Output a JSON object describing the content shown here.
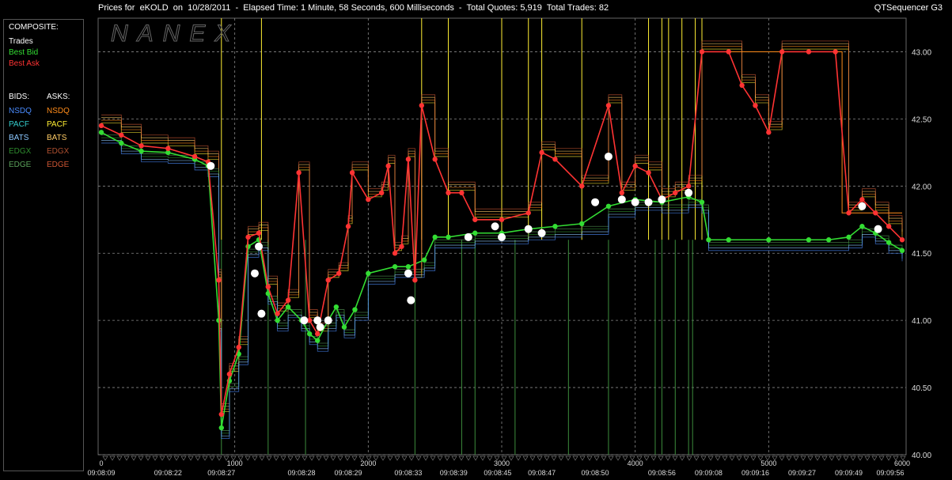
{
  "title": "Prices for  eKOLD  on  10/28/2011  -  Elapsed Time: 1 Minute, 58 Seconds, 600 Milliseconds  -  Total Quotes: 5,919  Total Trades: 82",
  "app_name": "QTSequencer G3",
  "watermark": "NANEX",
  "legend": {
    "composite_header": "COMPOSITE:",
    "composite": [
      {
        "label": "Trades",
        "color": "#ffffff"
      },
      {
        "label": "Best Bid",
        "color": "#33dd33"
      },
      {
        "label": "Best Ask",
        "color": "#ff3333"
      }
    ],
    "bids_header": "BIDS:",
    "asks_header": "ASKS:",
    "bids": [
      {
        "label": "NSDQ",
        "color": "#4a8cff"
      },
      {
        "label": "PACF",
        "color": "#33cccc"
      },
      {
        "label": "BATS",
        "color": "#8cc8ff"
      },
      {
        "label": "EDGX",
        "color": "#2e8b2e"
      },
      {
        "label": "EDGE",
        "color": "#5aa05a"
      }
    ],
    "asks": [
      {
        "label": "NSDQ",
        "color": "#ff8c1a"
      },
      {
        "label": "PACF",
        "color": "#ffee33"
      },
      {
        "label": "BATS",
        "color": "#ffcc66"
      },
      {
        "label": "EDGX",
        "color": "#b05030"
      },
      {
        "label": "EDGE",
        "color": "#cc5533"
      }
    ]
  },
  "chart_data": {
    "type": "line",
    "x_axis": {
      "ticks": [
        0,
        1000,
        2000,
        3000,
        4000,
        5000,
        6000
      ],
      "range": [
        0,
        6000
      ]
    },
    "y_axis": {
      "ticks": [
        "40.00",
        "40.50",
        "41.00",
        "41.50",
        "42.00",
        "42.50",
        "43.00"
      ],
      "range": [
        40.0,
        43.25
      ]
    },
    "time_labels": [
      "09:08:09",
      "09:08:22",
      "09:08:27",
      "09:08:28",
      "09:08:29",
      "09:08:33",
      "09:08:39",
      "09:08:45",
      "09:08:47",
      "09:08:50",
      "09:08:56",
      "09:09:08",
      "09:09:16",
      "09:09:27",
      "09:09:49",
      "09:09:56"
    ],
    "time_label_x": [
      0,
      500,
      900,
      1500,
      1850,
      2300,
      2640,
      2970,
      3300,
      3700,
      4200,
      4550,
      4900,
      5250,
      5600,
      6000
    ],
    "grid": true,
    "series": [
      {
        "name": "Best Bid",
        "color": "#33dd33",
        "points": [
          [
            0,
            42.4
          ],
          [
            150,
            42.32
          ],
          [
            300,
            42.26
          ],
          [
            500,
            42.25
          ],
          [
            700,
            42.2
          ],
          [
            800,
            42.15
          ],
          [
            880,
            41.0
          ],
          [
            900,
            40.2
          ],
          [
            960,
            40.55
          ],
          [
            1030,
            40.75
          ],
          [
            1100,
            41.55
          ],
          [
            1180,
            41.6
          ],
          [
            1250,
            41.2
          ],
          [
            1320,
            41.0
          ],
          [
            1400,
            41.1
          ],
          [
            1500,
            41.0
          ],
          [
            1560,
            40.9
          ],
          [
            1620,
            40.85
          ],
          [
            1700,
            41.0
          ],
          [
            1760,
            41.1
          ],
          [
            1820,
            40.95
          ],
          [
            1900,
            41.08
          ],
          [
            2000,
            41.35
          ],
          [
            2200,
            41.4
          ],
          [
            2300,
            41.4
          ],
          [
            2420,
            41.45
          ],
          [
            2500,
            41.62
          ],
          [
            2600,
            41.62
          ],
          [
            2800,
            41.65
          ],
          [
            3000,
            41.65
          ],
          [
            3200,
            41.68
          ],
          [
            3400,
            41.7
          ],
          [
            3600,
            41.72
          ],
          [
            3800,
            41.85
          ],
          [
            4000,
            41.9
          ],
          [
            4200,
            41.88
          ],
          [
            4400,
            41.92
          ],
          [
            4500,
            41.88
          ],
          [
            4550,
            41.6
          ],
          [
            4700,
            41.6
          ],
          [
            5000,
            41.6
          ],
          [
            5300,
            41.6
          ],
          [
            5450,
            41.6
          ],
          [
            5600,
            41.62
          ],
          [
            5700,
            41.7
          ],
          [
            5800,
            41.65
          ],
          [
            5900,
            41.58
          ],
          [
            6000,
            41.52
          ]
        ]
      },
      {
        "name": "Best Ask",
        "color": "#ff3333",
        "points": [
          [
            0,
            42.45
          ],
          [
            150,
            42.38
          ],
          [
            300,
            42.3
          ],
          [
            500,
            42.28
          ],
          [
            700,
            42.22
          ],
          [
            800,
            42.18
          ],
          [
            880,
            41.3
          ],
          [
            900,
            40.3
          ],
          [
            960,
            40.6
          ],
          [
            1030,
            40.8
          ],
          [
            1100,
            41.62
          ],
          [
            1180,
            41.65
          ],
          [
            1250,
            41.25
          ],
          [
            1320,
            41.05
          ],
          [
            1400,
            41.15
          ],
          [
            1480,
            42.1
          ],
          [
            1560,
            41.0
          ],
          [
            1620,
            40.9
          ],
          [
            1700,
            41.3
          ],
          [
            1780,
            41.35
          ],
          [
            1850,
            41.7
          ],
          [
            1880,
            42.1
          ],
          [
            2000,
            41.9
          ],
          [
            2100,
            41.95
          ],
          [
            2150,
            42.15
          ],
          [
            2200,
            41.5
          ],
          [
            2250,
            41.55
          ],
          [
            2300,
            42.2
          ],
          [
            2350,
            41.3
          ],
          [
            2400,
            42.6
          ],
          [
            2500,
            42.2
          ],
          [
            2600,
            41.95
          ],
          [
            2700,
            41.95
          ],
          [
            2800,
            41.75
          ],
          [
            3000,
            41.75
          ],
          [
            3200,
            41.8
          ],
          [
            3300,
            42.25
          ],
          [
            3400,
            42.2
          ],
          [
            3600,
            42.0
          ],
          [
            3800,
            42.6
          ],
          [
            3900,
            41.95
          ],
          [
            4000,
            42.15
          ],
          [
            4100,
            42.1
          ],
          [
            4200,
            41.9
          ],
          [
            4300,
            41.95
          ],
          [
            4400,
            42.0
          ],
          [
            4500,
            43.0
          ],
          [
            4700,
            43.0
          ],
          [
            4800,
            42.75
          ],
          [
            4900,
            42.6
          ],
          [
            5000,
            42.4
          ],
          [
            5100,
            43.0
          ],
          [
            5300,
            43.0
          ],
          [
            5500,
            43.0
          ],
          [
            5600,
            41.8
          ],
          [
            5700,
            41.9
          ],
          [
            5800,
            41.8
          ],
          [
            5900,
            41.7
          ],
          [
            6000,
            41.6
          ]
        ]
      },
      {
        "name": "Trades",
        "color": "#ffffff",
        "points": [
          [
            820,
            42.15
          ],
          [
            1180,
            41.55
          ],
          [
            1150,
            41.35
          ],
          [
            1200,
            41.05
          ],
          [
            1520,
            41.0
          ],
          [
            1620,
            41.0
          ],
          [
            1640,
            40.95
          ],
          [
            1700,
            41.0
          ],
          [
            2300,
            41.35
          ],
          [
            2320,
            41.15
          ],
          [
            2750,
            41.62
          ],
          [
            2950,
            41.7
          ],
          [
            3000,
            41.62
          ],
          [
            3200,
            41.68
          ],
          [
            3300,
            41.65
          ],
          [
            3700,
            41.88
          ],
          [
            3800,
            42.22
          ],
          [
            3900,
            41.9
          ],
          [
            4000,
            41.88
          ],
          [
            4100,
            41.88
          ],
          [
            4200,
            41.9
          ],
          [
            4400,
            41.95
          ],
          [
            5700,
            41.85
          ],
          [
            5820,
            41.68
          ]
        ]
      }
    ]
  }
}
